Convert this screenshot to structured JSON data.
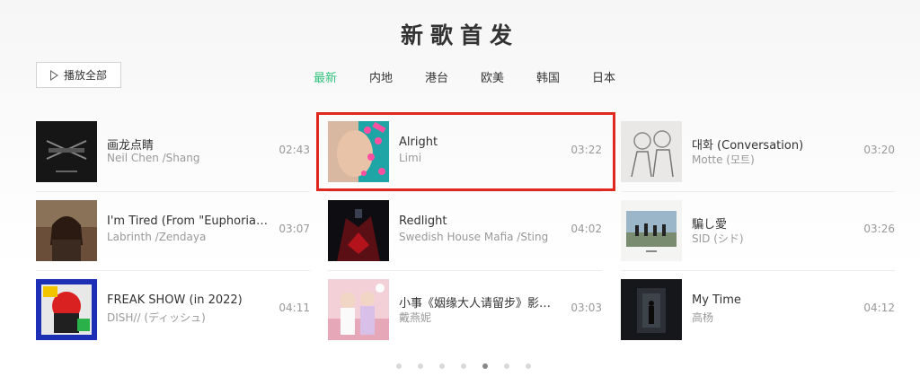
{
  "section_title": "新歌首发",
  "play_all_label": "播放全部",
  "tabs": [
    {
      "label": "最新",
      "active": true
    },
    {
      "label": "内地",
      "active": false
    },
    {
      "label": "港台",
      "active": false
    },
    {
      "label": "欧美",
      "active": false
    },
    {
      "label": "韩国",
      "active": false
    },
    {
      "label": "日本",
      "active": false
    }
  ],
  "songs": [
    {
      "title": "画龙点睛",
      "artist": "Neil Chen /Shang",
      "duration": "02:43",
      "cover": "cover-dark-calligraphy"
    },
    {
      "title": "I'm Tired (From \"Euphoria\" ...",
      "artist": "Labrinth /Zendaya",
      "duration": "03:07",
      "cover": "cover-portrait-woman"
    },
    {
      "title": "FREAK SHOW (in 2022)",
      "artist": "DISH// (ディッシュ)",
      "duration": "04:11",
      "cover": "cover-colorful-art"
    },
    {
      "title": "Alright",
      "artist": "Limi",
      "duration": "03:22",
      "cover": "cover-face-pink-dots",
      "highlighted": true
    },
    {
      "title": "Redlight",
      "artist": "Swedish House Mafia /Sting",
      "duration": "04:02",
      "cover": "cover-dark-red"
    },
    {
      "title": "小事《姻缘大人请留步》影视...",
      "artist": "戴燕妮",
      "duration": "03:03",
      "cover": "cover-pink-drama"
    },
    {
      "title": "대화 (Conversation)",
      "artist": "Motte (모트)",
      "duration": "03:20",
      "cover": "cover-sketch-people"
    },
    {
      "title": "騙し愛",
      "artist": "SID (シド)",
      "duration": "03:26",
      "cover": "cover-band-landscape"
    },
    {
      "title": "My Time",
      "artist": "高杨",
      "duration": "04:12",
      "cover": "cover-dark-room"
    }
  ],
  "pagination": {
    "total": 7,
    "active": 5
  },
  "colors": {
    "accent": "#31c27c",
    "highlight": "#e0281e"
  }
}
